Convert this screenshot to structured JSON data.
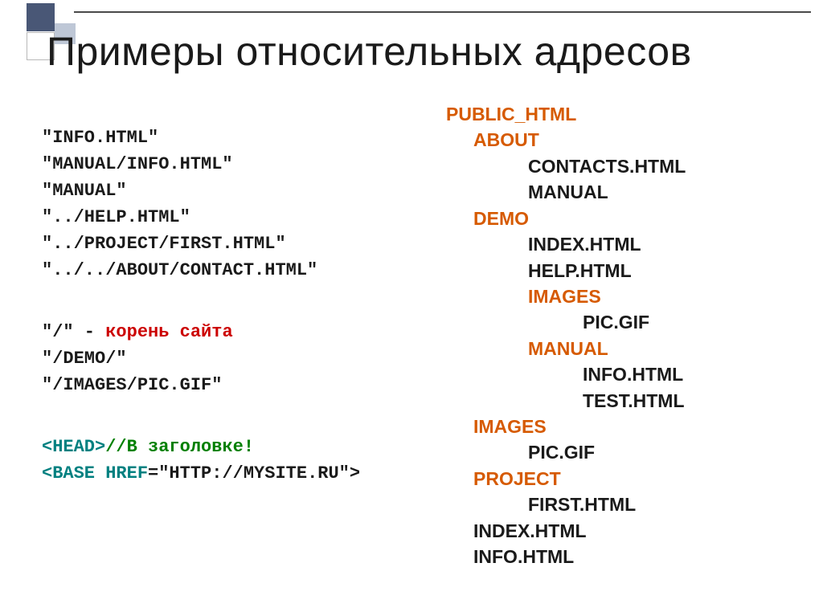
{
  "title": "Примеры относительных адресов",
  "left": {
    "block1": {
      "l1": "\"INFO.HTML\"",
      "l2": "\"MANUAL/INFO.HTML\"",
      "l3": "\"MANUAL\"",
      "l4": "\"../HELP.HTML\"",
      "l5": "\"../PROJECT/FIRST.HTML\"",
      "l6": "\"../../ABOUT/CONTACT.HTML\""
    },
    "block2": {
      "l1a": "\"/\" - ",
      "l1b": "корень сайта",
      "l2": "\"/DEMO/\"",
      "l3": "\"/IMAGES/PIC.GIF\""
    },
    "block3": {
      "l1a": "<HEAD>",
      "l1b": "//В заголовке!",
      "l2a": "<BASE HREF",
      "l2b": "=\"HTTP://MYSITE.RU\">"
    }
  },
  "tree": {
    "r0": "PUBLIC_HTML",
    "r1": "ABOUT",
    "r2": "CONTACTS.HTML",
    "r3": "MANUAL",
    "r4": "DEMO",
    "r5": "INDEX.HTML",
    "r6": "HELP.HTML",
    "r7": "IMAGES",
    "r8": "PIC.GIF",
    "r9": "MANUAL",
    "r10": "INFO.HTML",
    "r11": "TEST.HTML",
    "r12": "IMAGES",
    "r13": "PIC.GIF",
    "r14": "PROJECT",
    "r15": "FIRST.HTML",
    "r16": "INDEX.HTML",
    "r17": "INFO.HTML"
  }
}
